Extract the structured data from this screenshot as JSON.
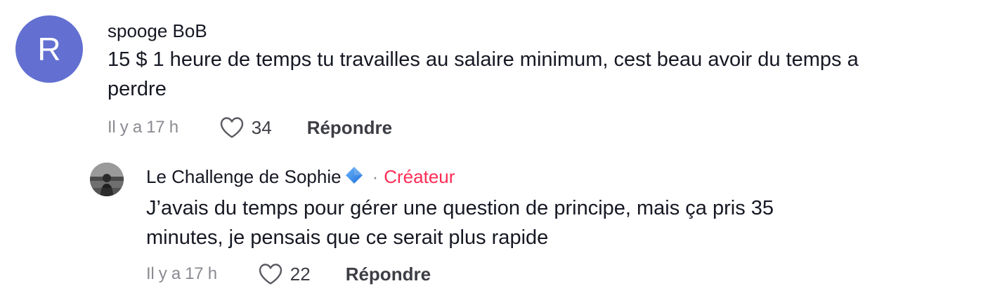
{
  "comments": [
    {
      "avatar_letter": "R",
      "avatar_color": "#6370d1",
      "username": "spooge BoB",
      "text_line1": "15 $ 1 heure de temps tu travailles au salaire minimum, cest beau avoir du temps a",
      "text_line2": "perdre",
      "time": "Il y a 17 h",
      "likes": "34",
      "reply_label": "Répondre",
      "like_icon": "heart-outline-icon"
    }
  ],
  "replies": [
    {
      "username": "Le Challenge de Sophie",
      "verified_icon": "blue-diamond-icon",
      "separator": "·",
      "creator_label": "Créateur",
      "creator_color": "#fe2c55",
      "text_line1": "J’avais du temps pour gérer une question de principe, mais ça pris 35",
      "text_line2": "minutes, je pensais que ce serait plus rapide",
      "time": "Il y a 17 h",
      "likes": "22",
      "reply_label": "Répondre",
      "like_icon": "heart-outline-icon"
    }
  ]
}
